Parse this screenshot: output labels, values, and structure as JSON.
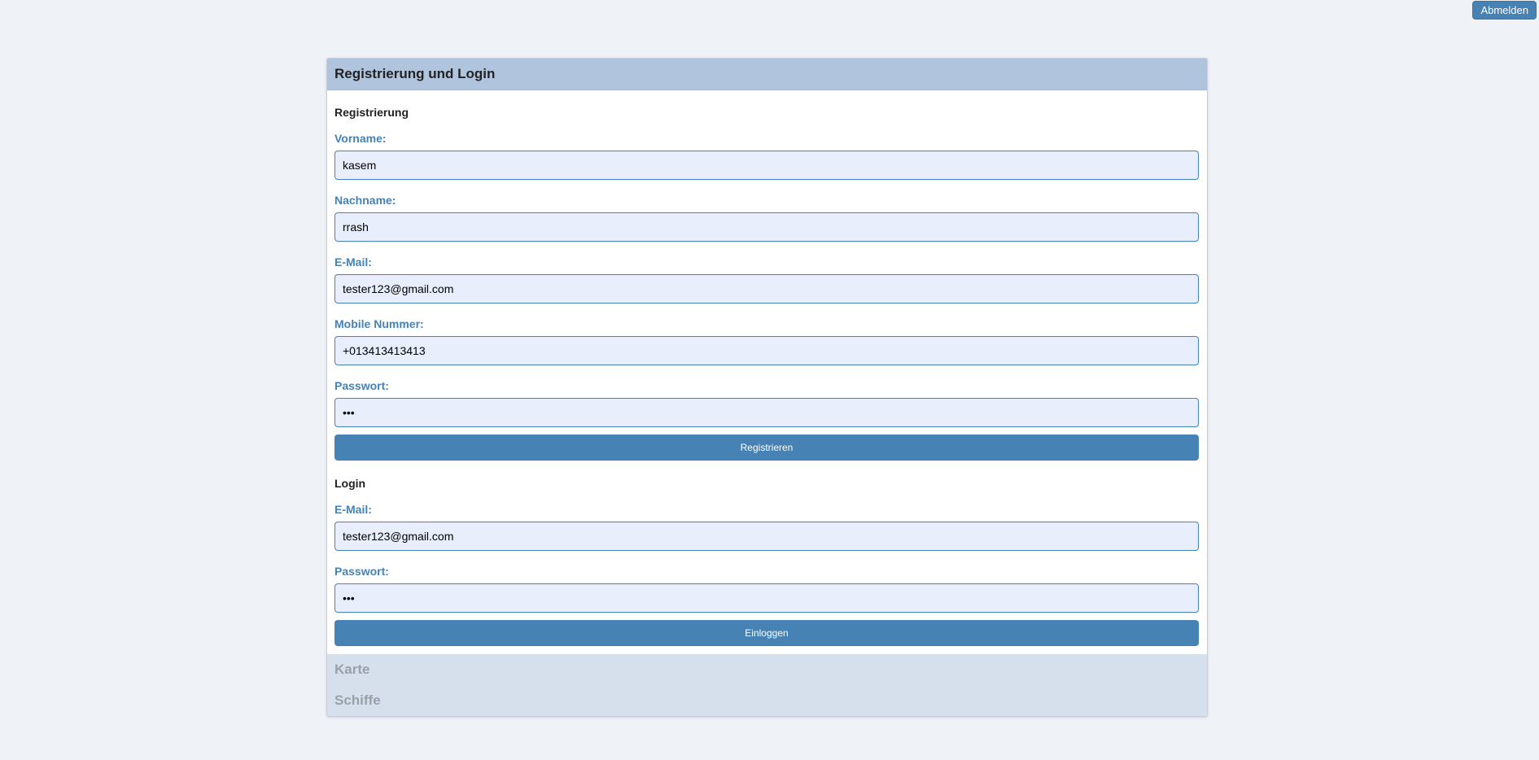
{
  "header": {
    "logout_label": "Abmelden"
  },
  "accordion": {
    "active_title": "Registrierung und Login",
    "registration": {
      "title": "Registrierung",
      "firstname_label": "Vorname:",
      "firstname_value": "kasem",
      "lastname_label": "Nachname:",
      "lastname_value": "rrash",
      "email_label": "E-Mail:",
      "email_value": "tester123@gmail.com",
      "mobile_label": "Mobile Nummer:",
      "mobile_value": "+013413413413",
      "password_label": "Passwort:",
      "password_value": "•••",
      "submit_label": "Registrieren"
    },
    "login": {
      "title": "Login",
      "email_label": "E-Mail:",
      "email_value": "tester123@gmail.com",
      "password_label": "Passwort:",
      "password_value": "•••",
      "submit_label": "Einloggen"
    },
    "collapsed_sections": [
      "Karte",
      "Schiffe"
    ]
  },
  "colors": {
    "accent": "#4682b4",
    "header_active": "#b0c4de",
    "header_collapsed": "#d6e0ec",
    "input_bg": "#e8eefc",
    "page_bg": "#eff2f7"
  }
}
